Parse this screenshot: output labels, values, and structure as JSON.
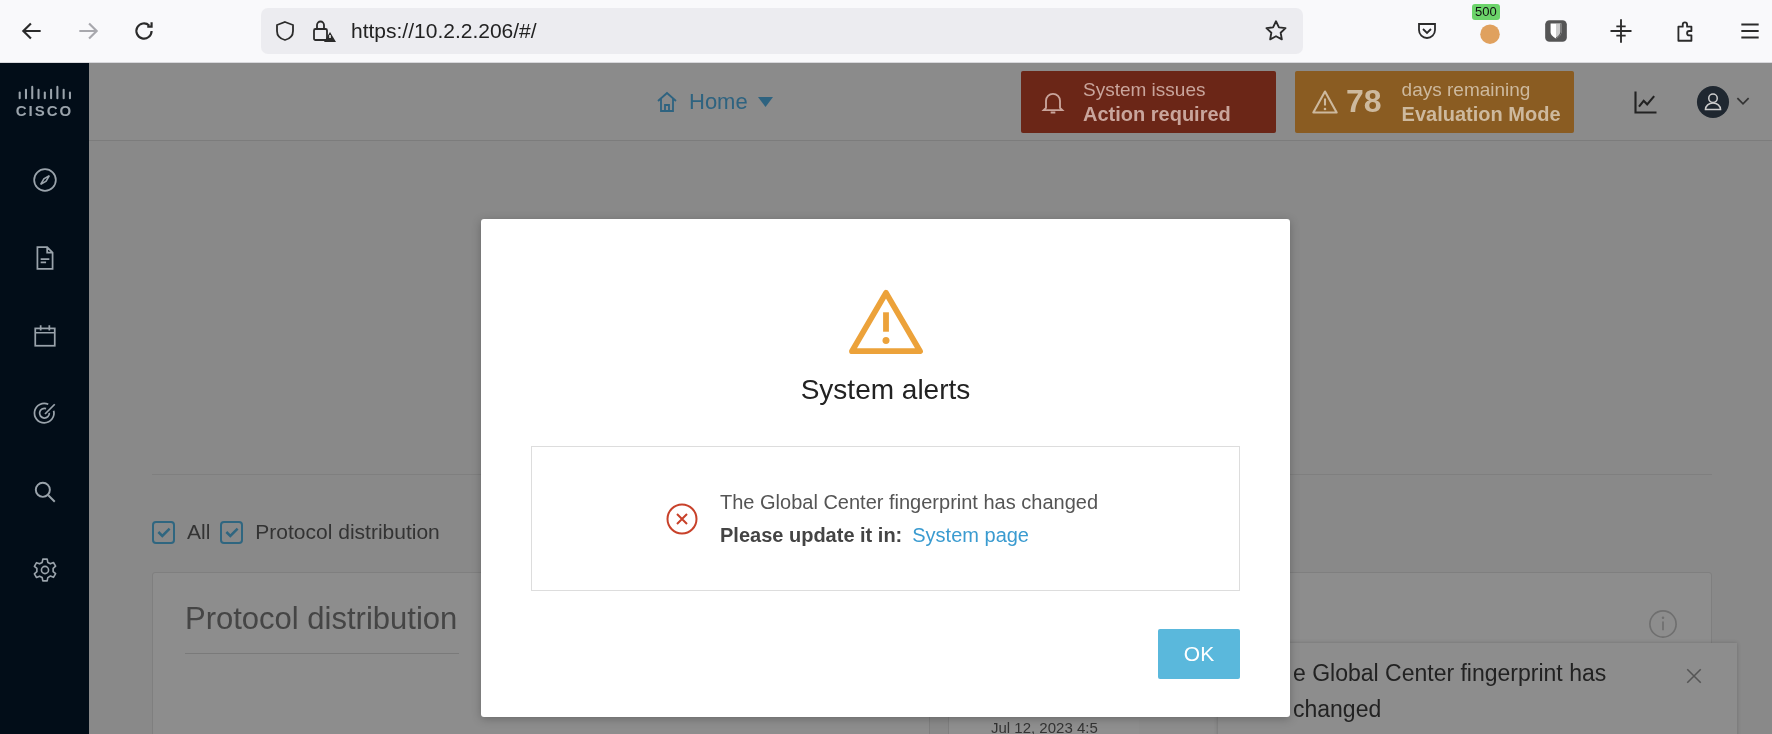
{
  "browser": {
    "url": "https://10.2.2.206/#/",
    "badge": "500"
  },
  "sidebar": {
    "logo": "CISCO",
    "items": [
      {
        "kind": "compass"
      },
      {
        "kind": "document"
      },
      {
        "kind": "calendar"
      },
      {
        "kind": "target"
      },
      {
        "kind": "search"
      },
      {
        "kind": "settings"
      }
    ]
  },
  "header": {
    "nav": "Home",
    "issues": {
      "title": "System issues",
      "action": "Action required"
    },
    "evaluation": {
      "days": "78",
      "label": "days remaining",
      "mode": "Evaluation Mode"
    }
  },
  "filters": [
    {
      "label": "All",
      "checked": true
    },
    {
      "label": "Protocol distribution",
      "checked": true
    }
  ],
  "cards": [
    {
      "title": "Protocol distribution"
    },
    {
      "timestamp": "Jul 12, 2023 4:5"
    }
  ],
  "dialog": {
    "title": "System alerts",
    "message": "The Global Center fingerprint has changed",
    "prompt": "Please update it in:",
    "link": "System page",
    "button": "OK"
  },
  "toast": {
    "lines": [
      "e Global Center fingerprint has",
      "changed"
    ]
  }
}
